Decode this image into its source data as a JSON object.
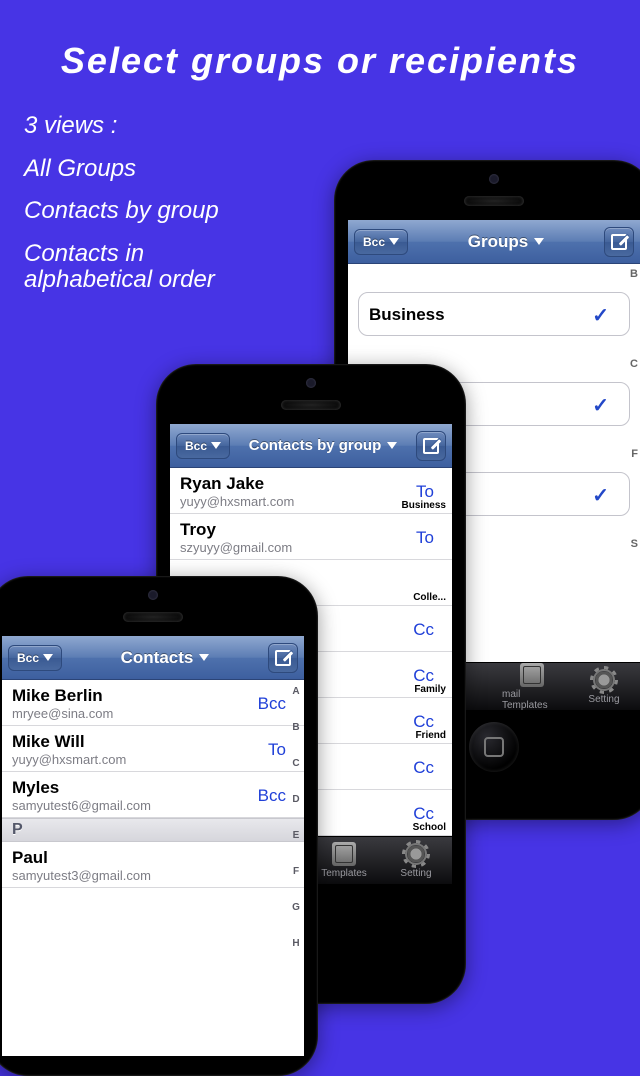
{
  "promo": {
    "title": "Select groups or recipients",
    "sub": "3 views :",
    "lines": [
      "All Groups",
      "Contacts by group",
      "Contacts in\nalphabetical order"
    ]
  },
  "bcc_label": "Bcc",
  "tabbar": {
    "templates": "mail Templates",
    "templates_short": "Templates",
    "setting": "Setting"
  },
  "phone1": {
    "title": "Contacts",
    "contacts": [
      {
        "name": "Mike Berlin",
        "email": "mryee@sina.com",
        "tag": "Bcc"
      },
      {
        "name": "Mike Will",
        "email": "yuyy@hxsmart.com",
        "tag": "To"
      },
      {
        "name": "Myles",
        "email": "samyutest6@gmail.com",
        "tag": "Bcc"
      }
    ],
    "section2": "P",
    "contacts2": [
      {
        "name": "Paul",
        "email": "samyutest3@gmail.com",
        "tag": ""
      }
    ],
    "index": [
      "A",
      "B",
      "C",
      "D",
      "E",
      "F",
      "G",
      "H"
    ]
  },
  "phone2": {
    "title": "Contacts by group",
    "rows": [
      {
        "name": "Ryan Jake",
        "email": "yuyy@hxsmart.com",
        "tag": "To",
        "grp": "Business"
      },
      {
        "name": "Troy",
        "email": "szyuyy@gmail.com",
        "tag": "To",
        "grp": ""
      },
      {
        "name": "",
        "email": "",
        "tag": "",
        "grp": "Colle..."
      },
      {
        "name": "",
        "email": "",
        "tag": "Cc",
        "grp": ""
      },
      {
        "name": "",
        "email": "",
        "tag": "Cc",
        "grp": "Family"
      },
      {
        "name": "",
        "email": "",
        "tag": "Cc",
        "grp": "Friend"
      },
      {
        "name": "",
        "email": "",
        "tag": "Cc",
        "grp": ""
      },
      {
        "name": "",
        "email": "",
        "tag": "Cc",
        "grp": "School"
      }
    ]
  },
  "phone3": {
    "title": "Groups",
    "sections": [
      {
        "letter": "B",
        "items": [
          {
            "label": "Business",
            "checked": true
          }
        ]
      },
      {
        "letter": "C",
        "items": [
          {
            "label": "",
            "checked": true
          }
        ]
      },
      {
        "letter": "F",
        "items": [
          {
            "label": "",
            "checked": true
          }
        ]
      },
      {
        "letter": "S",
        "items": []
      }
    ]
  }
}
